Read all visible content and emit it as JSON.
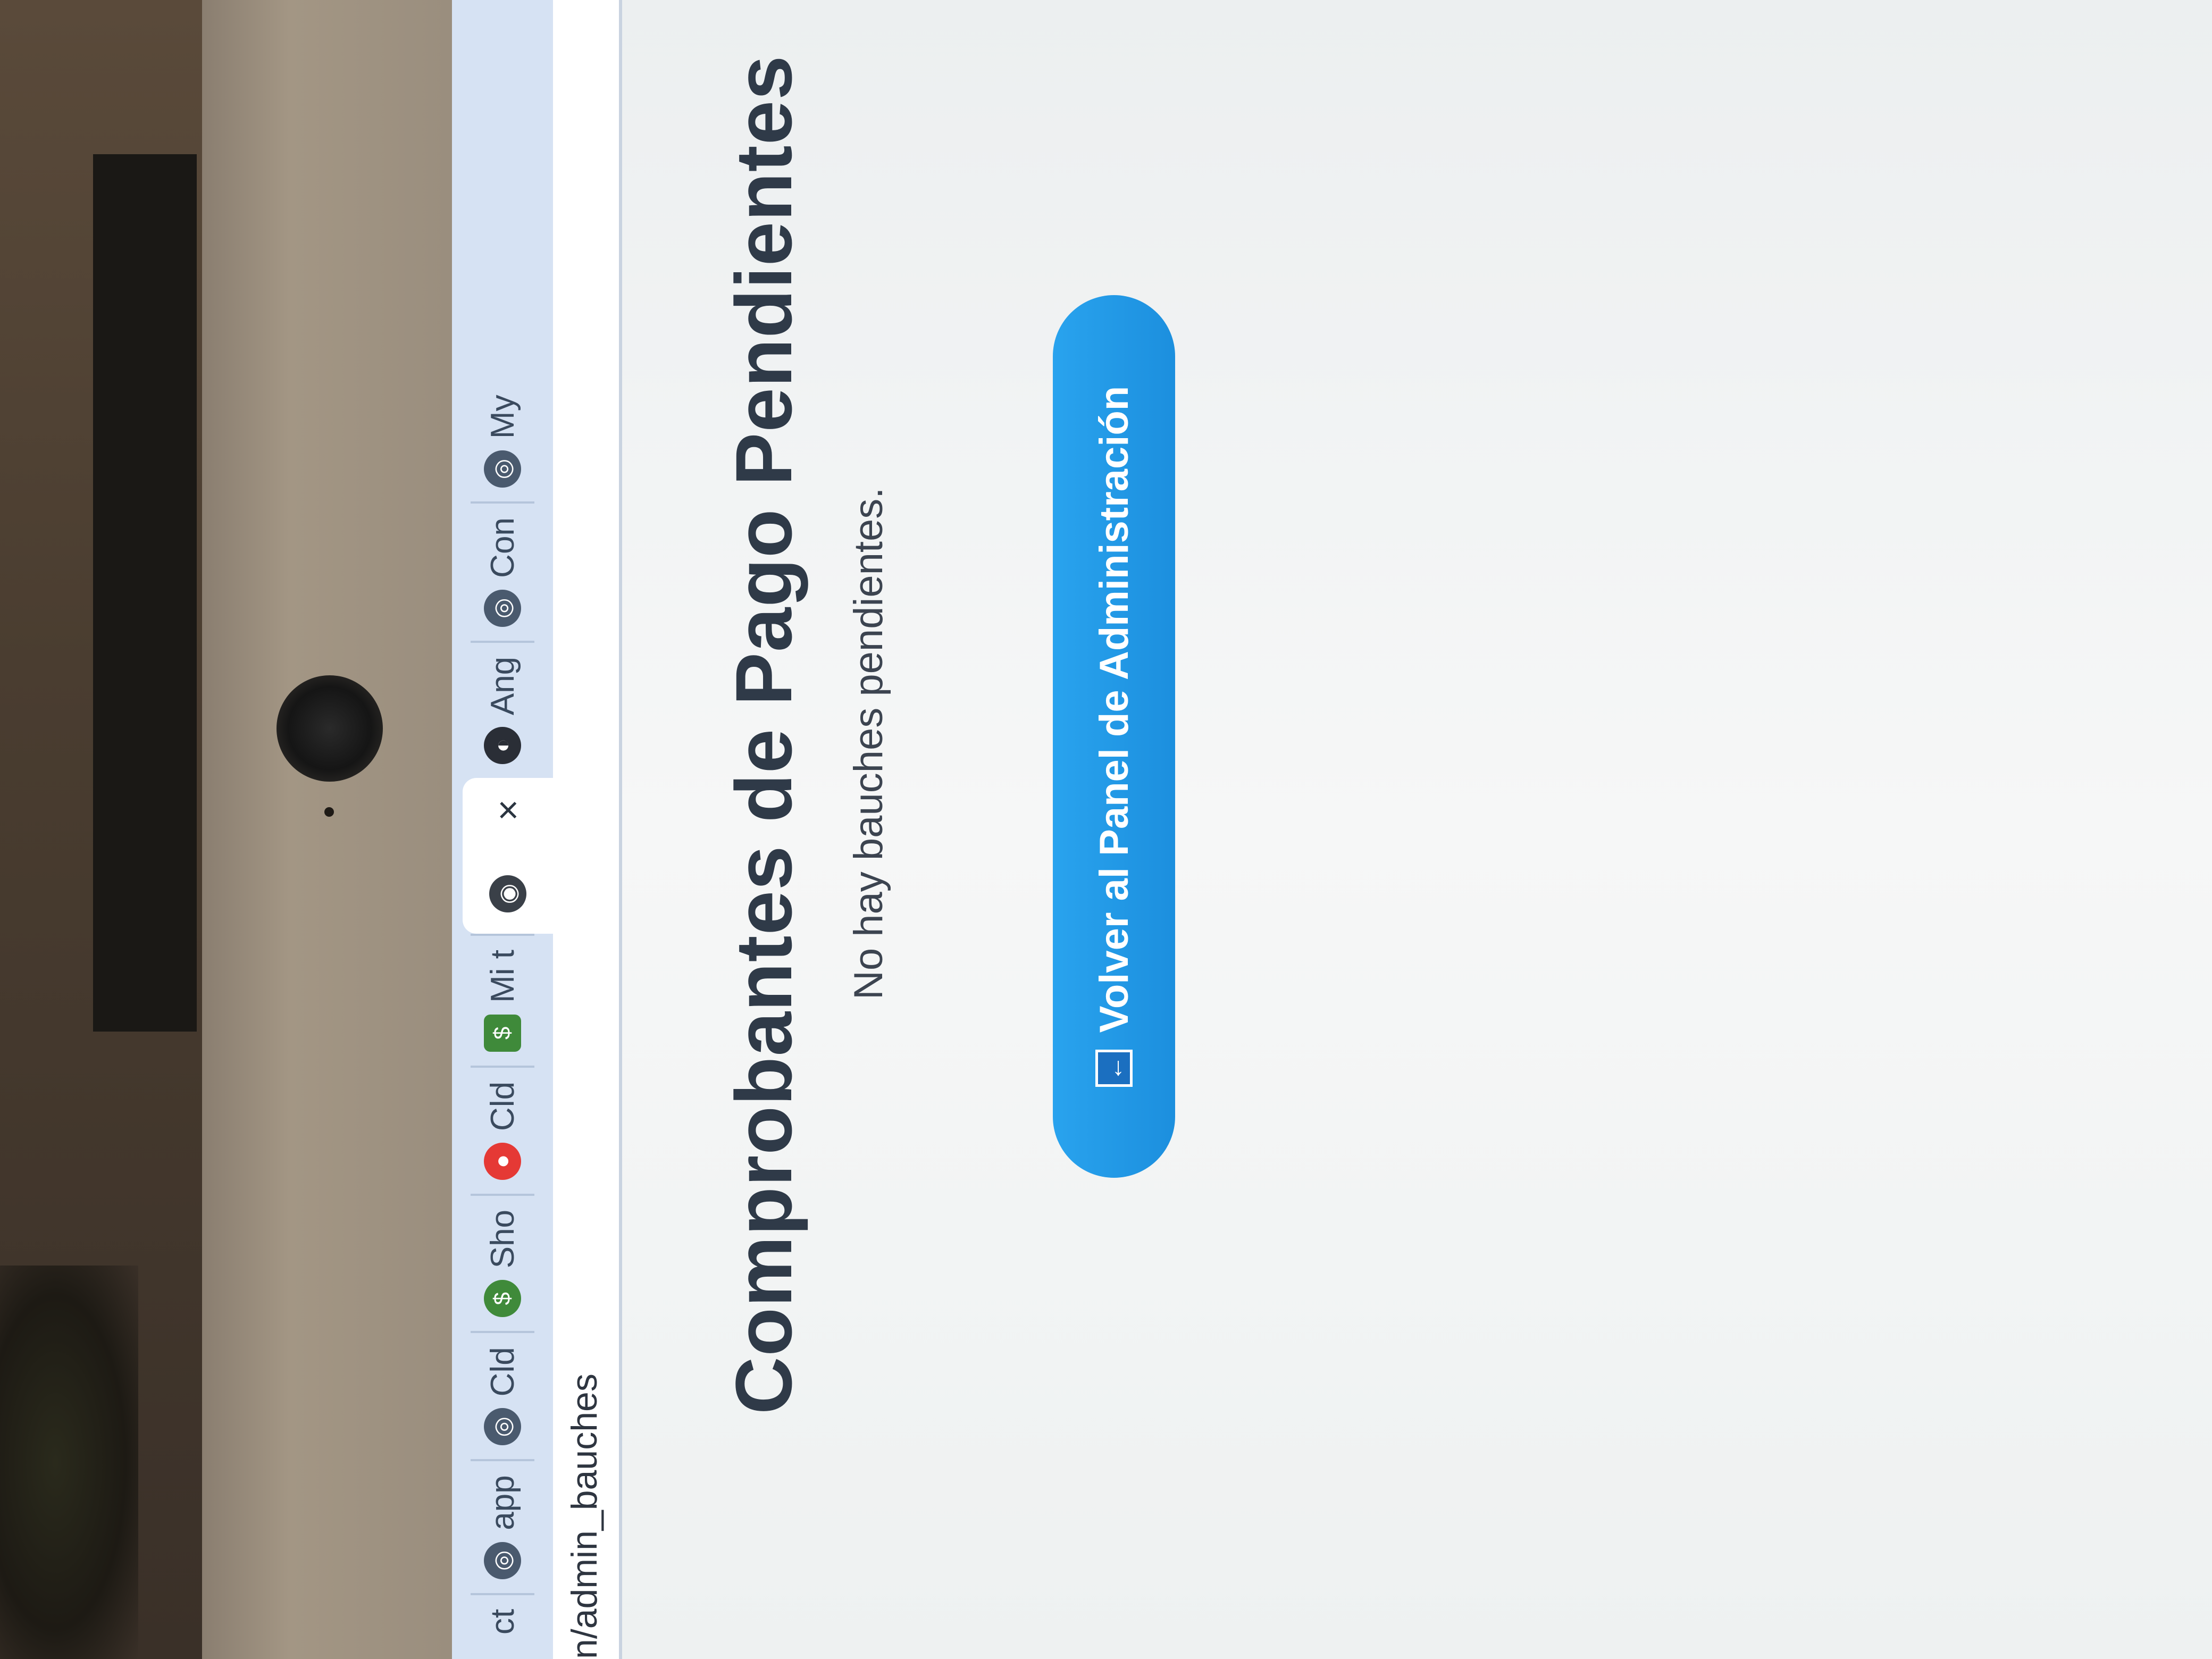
{
  "browser": {
    "tabs": [
      {
        "label": "ct",
        "icon": "favicon-icon"
      },
      {
        "label": "app",
        "icon": "globe-icon"
      },
      {
        "label": "Cld",
        "icon": "globe-icon"
      },
      {
        "label": "Sho",
        "icon": "shopify-icon"
      },
      {
        "label": "Cld",
        "icon": "record-icon"
      },
      {
        "label": "Mi t",
        "icon": "shopify-icon"
      },
      {
        "label": "",
        "icon": "globe-icon",
        "active": true
      },
      {
        "label": "Ang",
        "icon": "github-icon"
      },
      {
        "label": "Con",
        "icon": "globe-icon"
      },
      {
        "label": "My",
        "icon": "globe-icon"
      }
    ],
    "close_glyph": "×",
    "address": "n/admin_bauches"
  },
  "page": {
    "title": "Comprobantes de Pago Pendientes",
    "empty_message": "No hay bauches pendientes.",
    "back_button": {
      "label": "Volver al Panel de Administración",
      "icon": "arrow-left-icon",
      "icon_glyph": "←"
    }
  },
  "colors": {
    "accent": "#1c8fde",
    "title_text": "#2f3a48",
    "tabbar_bg": "#d6e2f3"
  }
}
